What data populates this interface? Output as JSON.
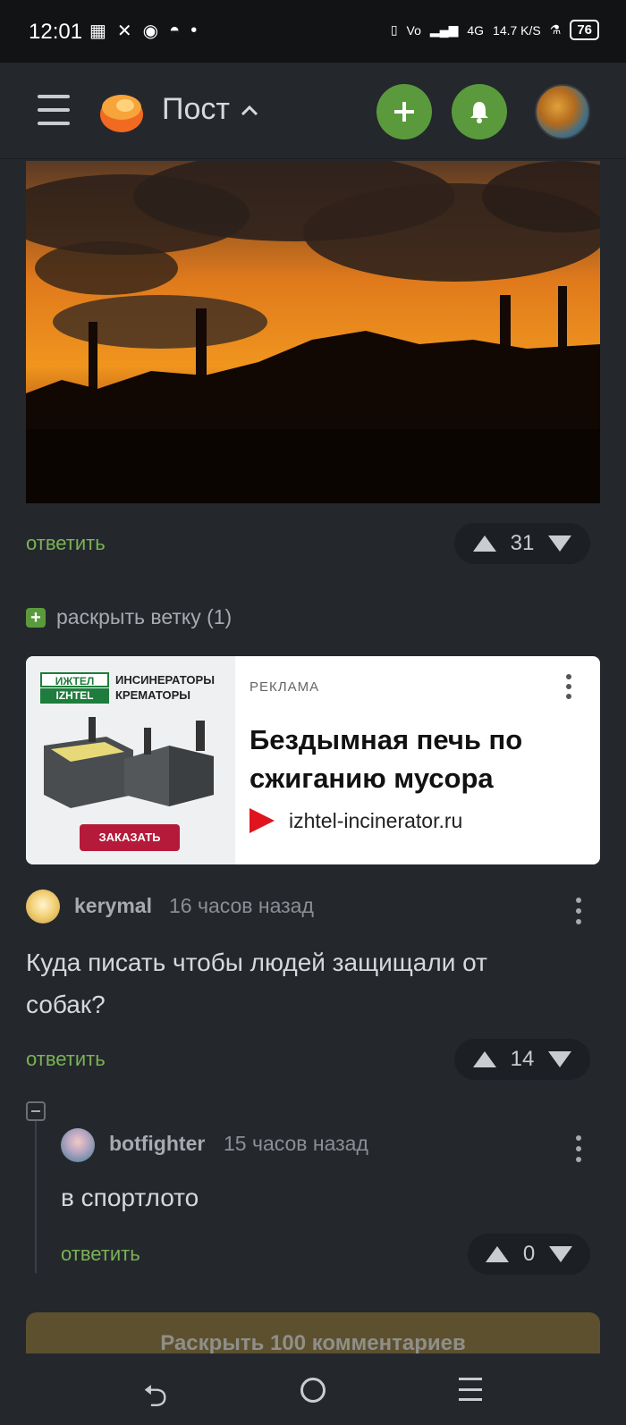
{
  "status_bar": {
    "time": "12:01",
    "network": "4G",
    "speed": "14.7 K/S",
    "battery": "76"
  },
  "app_header": {
    "title": "Пост",
    "add_icon": "plus-icon",
    "notify_icon": "bell-icon",
    "accent_color": "#5b9a3c"
  },
  "post": {
    "reply_label": "ответить",
    "rating": "31",
    "expand_branch_label": "раскрыть ветку (1)"
  },
  "ad": {
    "brand_ru": "ИЖТЕЛ",
    "brand_en": "IZHTEL",
    "brand_tagline_1": "ИНСИНЕРАТОРЫ",
    "brand_tagline_2": "КРЕМАТОРЫ",
    "order_button": "ЗАКАЗАТЬ",
    "label": "РЕКЛАМА",
    "headline": "Бездымная печь по сжиганию мусора",
    "url": "izhtel-incinerator.ru"
  },
  "comments": [
    {
      "username": "kerymal",
      "time_ago": "16 часов назад",
      "text": "Куда писать чтобы людей защищали от собак?",
      "reply_label": "ответить",
      "rating": "14"
    },
    {
      "username": "botfighter",
      "time_ago": "15 часов назад",
      "text": "в спортлото",
      "reply_label": "ответить",
      "rating": "0"
    }
  ],
  "more_comments_button": "Раскрыть 100 комментариев"
}
